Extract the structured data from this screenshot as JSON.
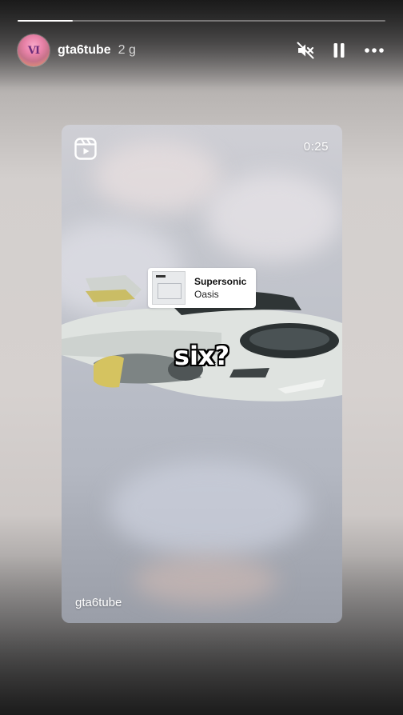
{
  "story": {
    "progress": 0.15,
    "username": "gta6tube",
    "time_ago": "2 g",
    "avatar_text": "VI"
  },
  "controls": {
    "mute_icon": "speaker-muted-icon",
    "pause_icon": "pause-icon",
    "more_icon": "more-options-icon"
  },
  "reel": {
    "icon": "reels-icon",
    "duration": "0:25",
    "caption": "six?",
    "author": "gta6tube"
  },
  "music": {
    "title": "Supersonic",
    "artist": "Oasis"
  },
  "colors": {
    "sticker_bg": "#ffffff",
    "text_primary": "#ffffff"
  }
}
